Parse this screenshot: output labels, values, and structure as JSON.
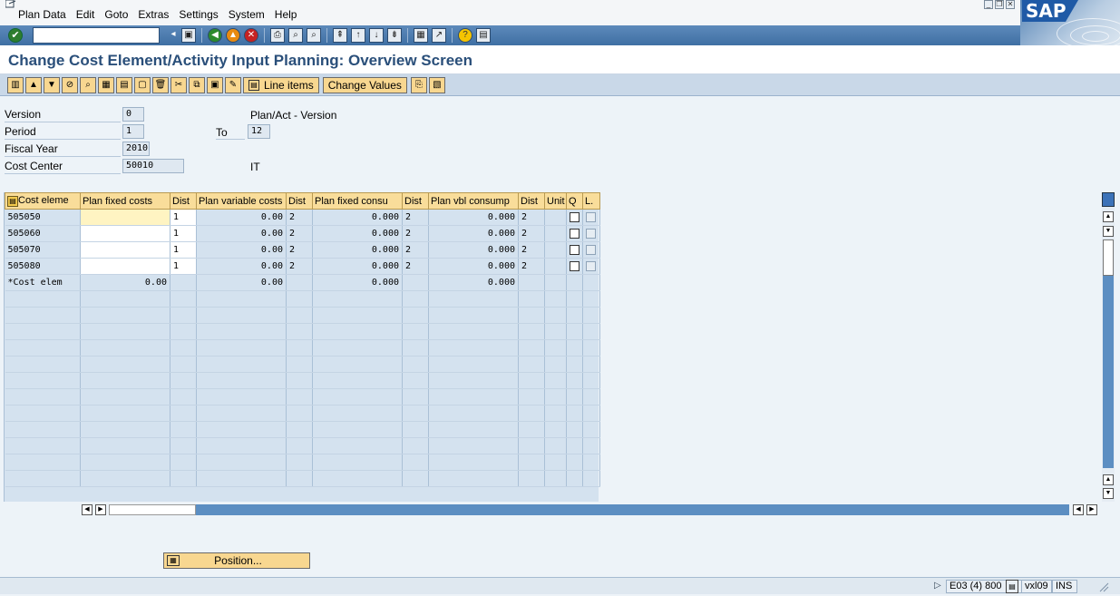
{
  "menu": [
    "Plan Data",
    "Edit",
    "Goto",
    "Extras",
    "Settings",
    "System",
    "Help"
  ],
  "logo_text": "SAP",
  "command_field": {
    "value": ""
  },
  "title": "Change Cost Element/Activity Input Planning: Overview Screen",
  "app_toolbar": {
    "line_items": "Line items",
    "change_values": "Change Values"
  },
  "header": {
    "version": {
      "label": "Version",
      "value": "0",
      "text": "Plan/Act - Version"
    },
    "period": {
      "label": "Period",
      "value": "1",
      "to_label": "To",
      "to_value": "12"
    },
    "fiscal_year": {
      "label": "Fiscal Year",
      "value": "2010"
    },
    "cost_center": {
      "label": "Cost Center",
      "value": "50010",
      "text": "IT"
    }
  },
  "table": {
    "columns": [
      "Cost eleme",
      "Plan fixed costs",
      "Dist",
      "Plan variable costs",
      "Dist",
      "Plan fixed consu",
      "Dist",
      "Plan vbl consump",
      "Dist",
      "Unit",
      "Q",
      "L."
    ],
    "rows": [
      {
        "cost_element": "505050",
        "fixed": "",
        "dist1": "1",
        "var": "0.00",
        "dist2": "2",
        "fixcons": "0.000",
        "dist3": "2",
        "vblcons": "0.000",
        "dist4": "2"
      },
      {
        "cost_element": "505060",
        "fixed": "",
        "dist1": "1",
        "var": "0.00",
        "dist2": "2",
        "fixcons": "0.000",
        "dist3": "2",
        "vblcons": "0.000",
        "dist4": "2"
      },
      {
        "cost_element": "505070",
        "fixed": "",
        "dist1": "1",
        "var": "0.00",
        "dist2": "2",
        "fixcons": "0.000",
        "dist3": "2",
        "vblcons": "0.000",
        "dist4": "2"
      },
      {
        "cost_element": "505080",
        "fixed": "",
        "dist1": "1",
        "var": "0.00",
        "dist2": "2",
        "fixcons": "0.000",
        "dist3": "2",
        "vblcons": "0.000",
        "dist4": "2"
      }
    ],
    "total": {
      "label": "*Cost elem",
      "fixed": "0.00",
      "var": "0.00",
      "fixcons": "0.000",
      "vblcons": "0.000"
    }
  },
  "position_button": "Position...",
  "status": {
    "system": "E03 (4) 800",
    "server": "vxl09",
    "mode": "INS"
  }
}
